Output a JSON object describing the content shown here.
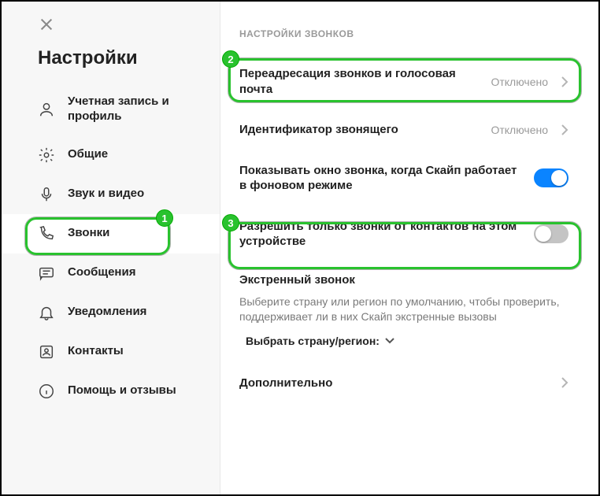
{
  "sidebar": {
    "title": "Настройки",
    "items": [
      {
        "label": "Учетная запись и профиль"
      },
      {
        "label": "Общие"
      },
      {
        "label": "Звук и видео"
      },
      {
        "label": "Звонки"
      },
      {
        "label": "Сообщения"
      },
      {
        "label": "Уведомления"
      },
      {
        "label": "Контакты"
      },
      {
        "label": "Помощь и отзывы"
      }
    ]
  },
  "main": {
    "section_title": "НАСТРОЙКИ ЗВОНКОВ",
    "forwarding": {
      "label": "Переадресация звонков и голосовая почта",
      "status": "Отключено"
    },
    "caller_id": {
      "label": "Идентификатор звонящего",
      "status": "Отключено"
    },
    "show_window": {
      "label": "Показывать окно звонка, когда Скайп работает в фоновом режиме",
      "on": true
    },
    "only_contacts": {
      "label": "Разрешить только звонки от контактов на этом устройстве",
      "on": false
    },
    "emergency": {
      "title": "Экстренный звонок",
      "desc": "Выберите страну или регион по умолчанию, чтобы проверить, поддерживает ли в них Скайп экстренные вызовы",
      "select_label": "Выбрать страну/регион:"
    },
    "more": {
      "label": "Дополнительно"
    }
  },
  "callouts": {
    "c1": "1",
    "c2": "2",
    "c3": "3"
  }
}
